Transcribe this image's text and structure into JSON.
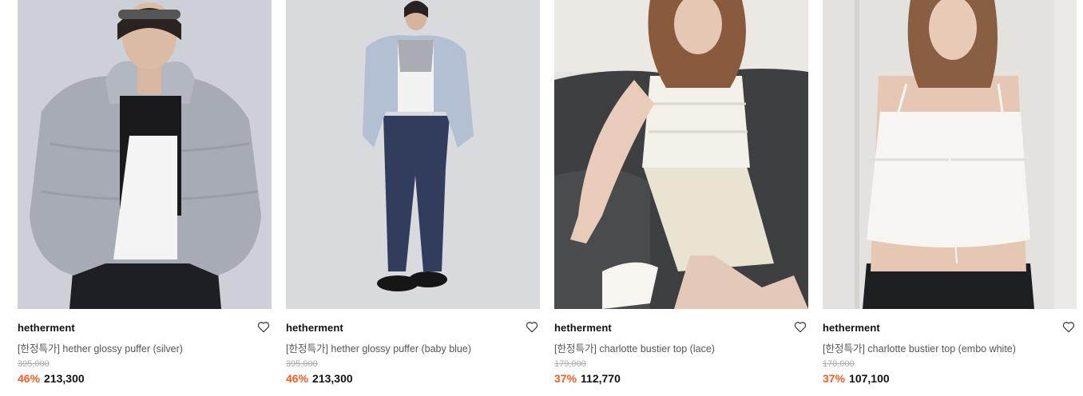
{
  "products": [
    {
      "brand": "hetherment",
      "name": "[한정특가] hether glossy puffer (silver)",
      "original_price": "395,000",
      "discount": "46%",
      "price": "213,300",
      "image": "model-silver-puffer",
      "colors": {
        "bg": "#c9ccd2",
        "garment": "#a7acb4",
        "bottom": "#1e1f24"
      }
    },
    {
      "brand": "hetherment",
      "name": "[한정특가] hether glossy puffer (baby blue)",
      "original_price": "395,000",
      "discount": "46%",
      "price": "213,300",
      "image": "model-baby-blue-puffer",
      "colors": {
        "bg": "#d9dadd",
        "garment": "#b3bfd2",
        "bottom": "#323d5e"
      }
    },
    {
      "brand": "hetherment",
      "name": "[한정특가] charlotte bustier top (lace)",
      "original_price": "179,000",
      "discount": "37%",
      "price": "112,770",
      "image": "model-lace-bustier-on-sofa",
      "colors": {
        "bg": "#e6e4e0",
        "garment": "#f3f0ea",
        "bottom": "#3e3f41"
      }
    },
    {
      "brand": "hetherment",
      "name": "[한정특가] charlotte bustier top (embo white)",
      "original_price": "170,000",
      "discount": "37%",
      "price": "107,100",
      "image": "model-embo-white-bustier",
      "colors": {
        "bg": "#e4e2df",
        "garment": "#f6f5f2",
        "bottom": "#1d1e22"
      }
    }
  ],
  "icons": {
    "wishlist": "heart-outline-icon"
  },
  "accent": "#ff5a1f"
}
